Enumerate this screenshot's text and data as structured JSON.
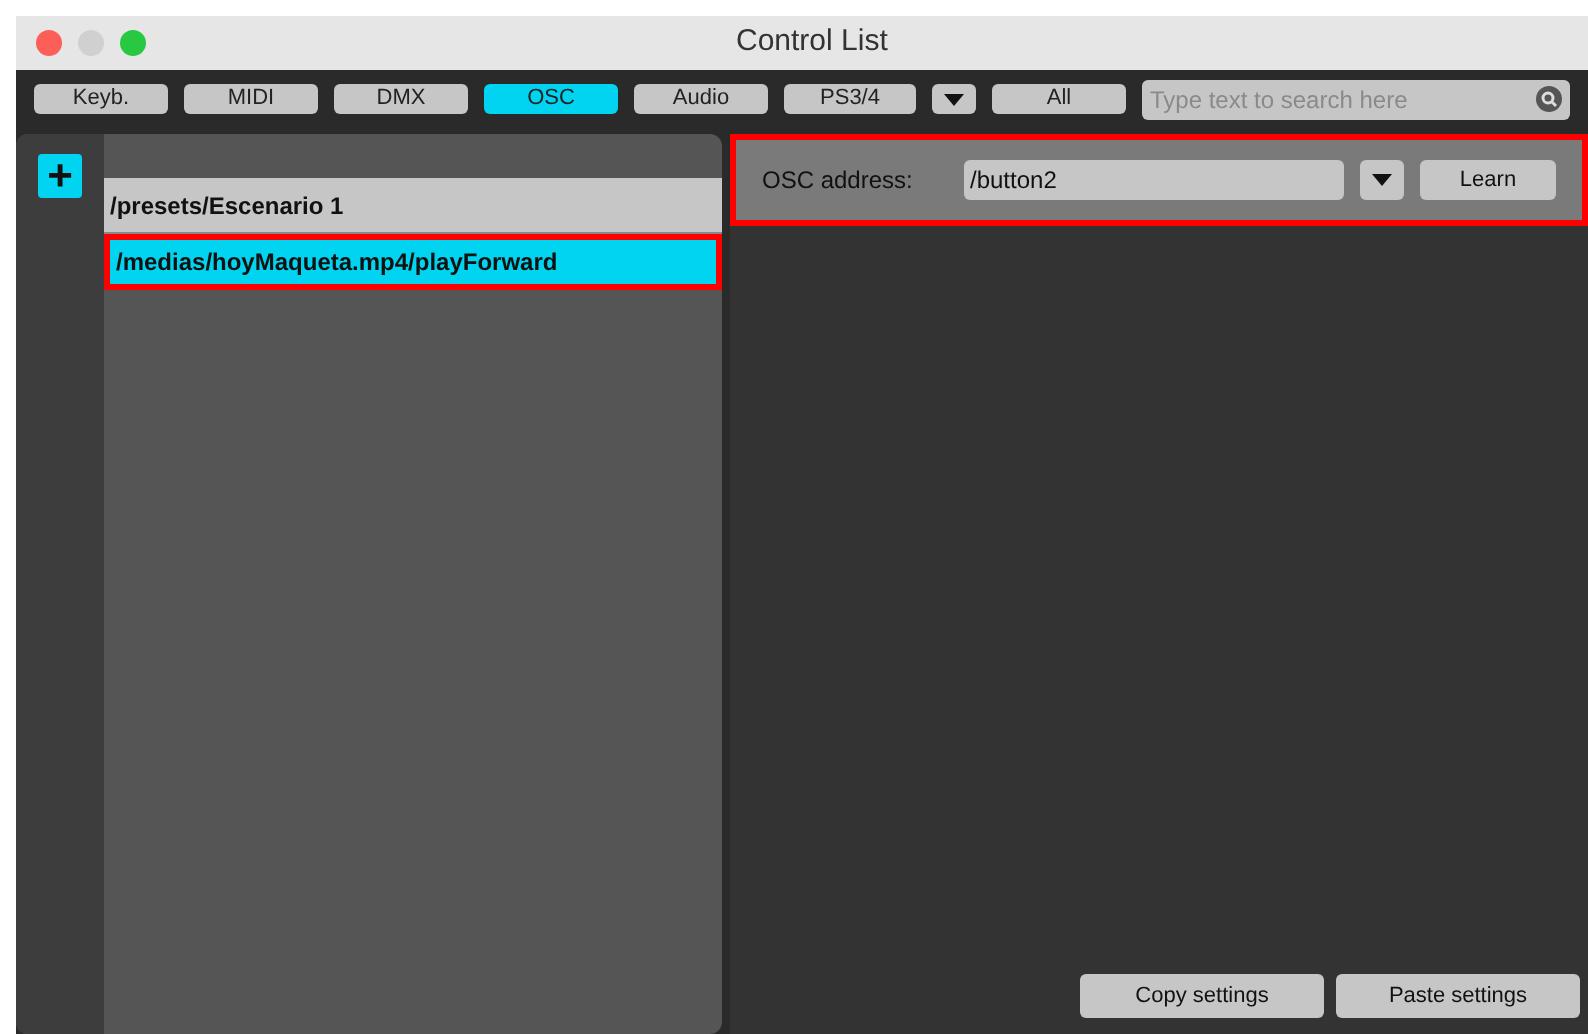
{
  "window": {
    "title": "Control List"
  },
  "tabs": [
    {
      "label": "Keyb.",
      "selected": false
    },
    {
      "label": "MIDI",
      "selected": false
    },
    {
      "label": "DMX",
      "selected": false
    },
    {
      "label": "OSC",
      "selected": true
    },
    {
      "label": "Audio",
      "selected": false
    },
    {
      "label": "PS3/4",
      "selected": false
    }
  ],
  "all_button": "All",
  "search": {
    "placeholder": "Type text to search here"
  },
  "add_button": "+",
  "controls": [
    {
      "label": "/presets/Escenario 1",
      "selected": false,
      "highlighted": false
    },
    {
      "label": "/medias/hoyMaqueta.mp4/playForward",
      "selected": true,
      "highlighted": true
    }
  ],
  "osc": {
    "label": "OSC address:",
    "value": "/button2",
    "learn": "Learn",
    "highlighted": true
  },
  "buttons": [
    "Copy settings",
    "Paste settings"
  ]
}
